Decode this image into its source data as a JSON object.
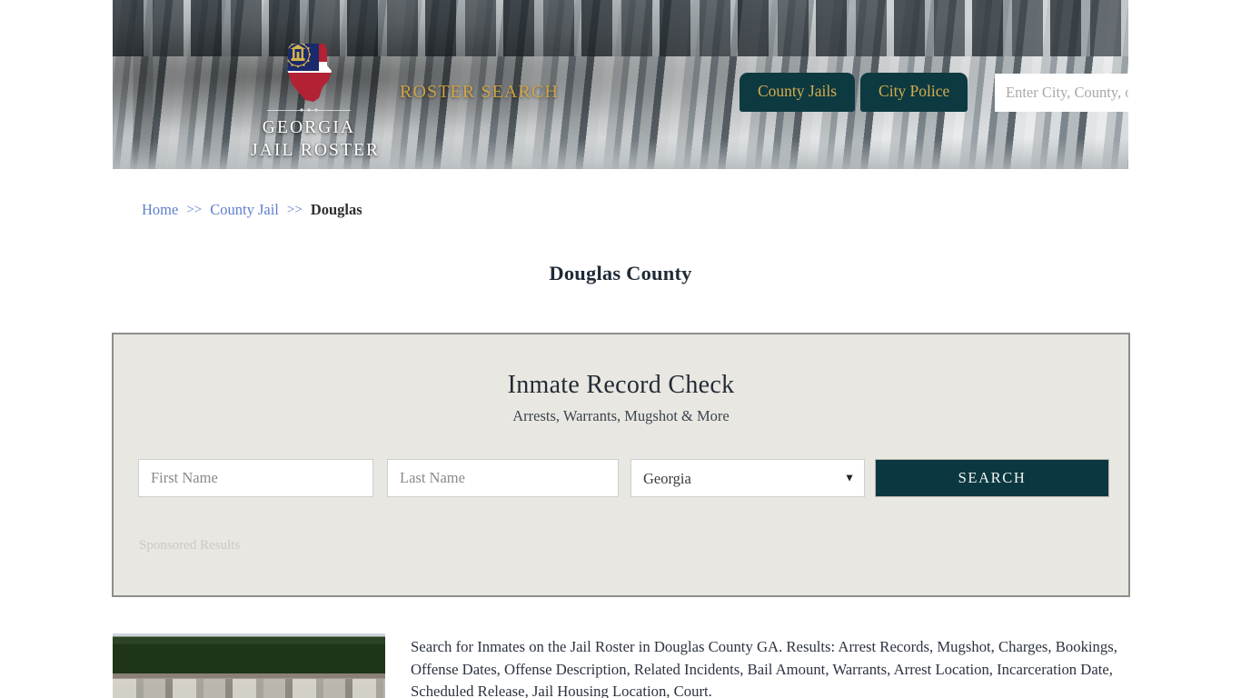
{
  "site": {
    "logo_line1": "GEORGIA",
    "logo_line2": "JAIL ROSTER",
    "logo_icon": "georgia-state-flag-icon",
    "tagline": "ROSTER SEARCH"
  },
  "header": {
    "nav": [
      {
        "label": "County Jails",
        "name": "nav-county-jails"
      },
      {
        "label": "City Police",
        "name": "nav-city-police"
      }
    ],
    "search": {
      "placeholder": "Enter City, County, or Facility",
      "value": "",
      "button_icon": "search-icon"
    }
  },
  "breadcrumb": {
    "home": "Home",
    "sep1": ">>",
    "county_jail": "County Jail",
    "sep2": ">>",
    "current": "Douglas"
  },
  "page": {
    "title": "Douglas County"
  },
  "record_check": {
    "title": "Inmate Record Check",
    "subtitle": "Arrests, Warrants, Mugshot & More",
    "first_name_placeholder": "First Name",
    "first_name_value": "",
    "last_name_placeholder": "Last Name",
    "last_name_value": "",
    "state_selected": "Georgia",
    "state_options": [
      "Georgia"
    ],
    "search_label": "SEARCH",
    "sponsored_label": "Sponsored Results"
  },
  "content": {
    "thumbnail_alt": "douglas-county-jail-aerial-photo",
    "paragraph": "Search for Inmates on the Jail Roster in Douglas County GA. Results: Arrest Records, Mugshot, Charges, Bookings, Offense Dates, Offense Description, Related Incidents, Bail Amount, Warrants, Arrest Location, Incarceration Date, Scheduled Release, Jail Housing Location, Court."
  },
  "colors": {
    "teal": "#0d3a40",
    "gold": "#d7ad4c",
    "panel_bg": "#e9e7e1",
    "link_blue": "#5d7fd0"
  }
}
